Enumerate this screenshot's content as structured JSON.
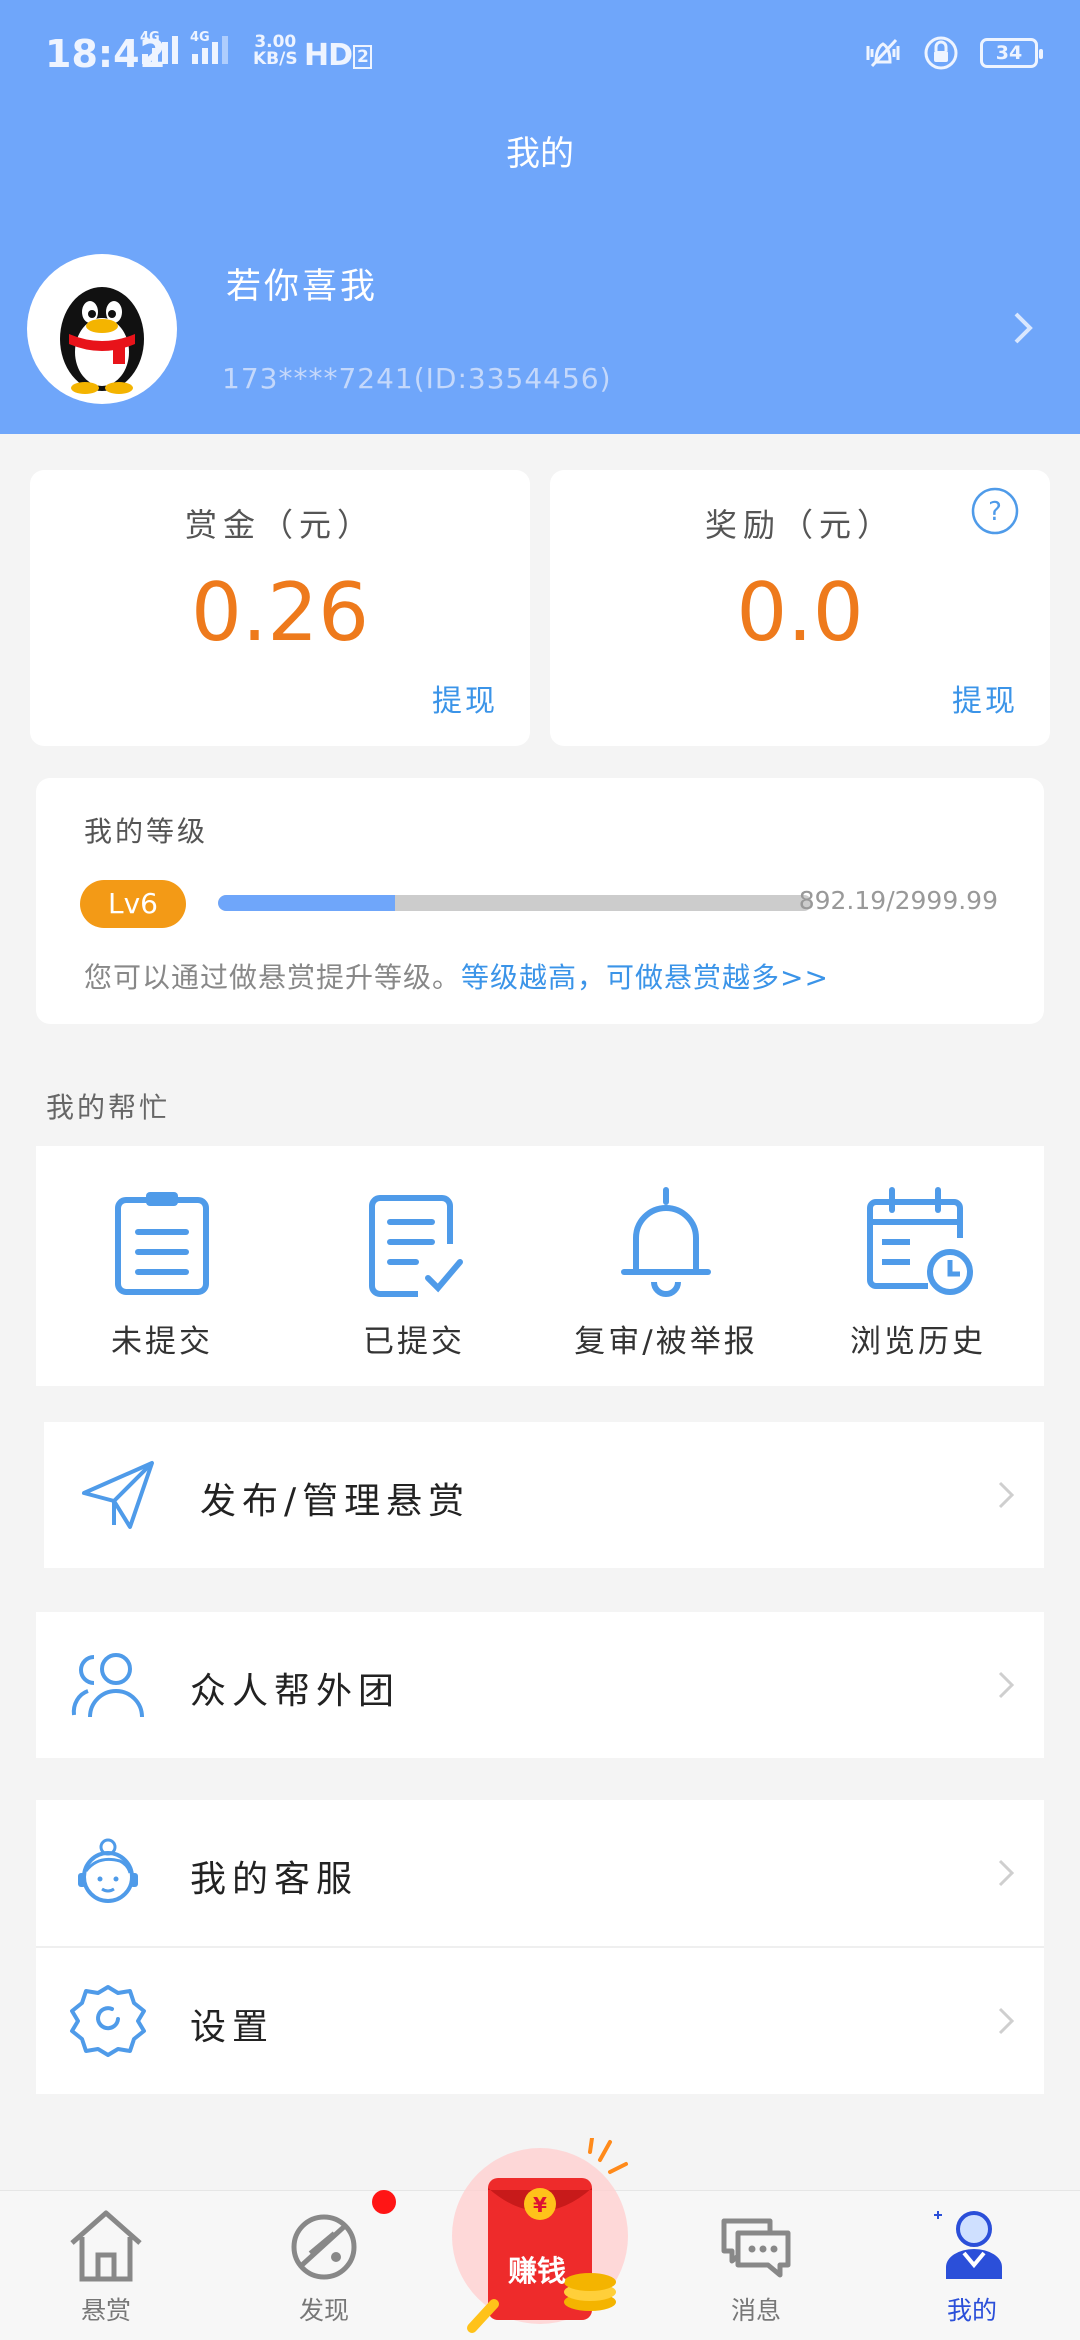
{
  "status_bar": {
    "time": "18:42",
    "network_tag_1": "4G",
    "network_tag_2": "4G",
    "speed_value": "3.00",
    "speed_unit": "KB/S",
    "hd": "HD",
    "hd_num": "2",
    "battery": "34"
  },
  "header": {
    "title": "我的",
    "username": "若你喜我",
    "user_id": "173****7241(ID:3354456)"
  },
  "wallet": {
    "bounty_label": "赏金（元）",
    "bounty_value": "0.26",
    "bounty_withdraw": "提现",
    "reward_label": "奖励（元）",
    "reward_value": "0.0",
    "reward_withdraw": "提现"
  },
  "level": {
    "title": "我的等级",
    "badge": "Lv6",
    "progress": 0.2975,
    "score": "892.19/2999.99",
    "tip": "您可以通过做悬赏提升等级。",
    "tip_link": "等级越高，可做悬赏越多>>"
  },
  "help": {
    "section_title": "我的帮忙",
    "items": [
      {
        "label": "未提交",
        "icon": "clipboard-icon"
      },
      {
        "label": "已提交",
        "icon": "checked-document-icon"
      },
      {
        "label": "复审/被举报",
        "icon": "bell-icon"
      },
      {
        "label": "浏览历史",
        "icon": "calendar-clock-icon"
      }
    ]
  },
  "menu": {
    "publish": "发布/管理悬赏",
    "team": "众人帮外团",
    "service": "我的客服",
    "settings": "设置"
  },
  "nav": {
    "items": [
      {
        "label": "悬赏",
        "icon": "home-icon"
      },
      {
        "label": "发现",
        "icon": "planet-icon"
      },
      {
        "label": "消息",
        "icon": "chat-icon"
      },
      {
        "label": "我的",
        "icon": "profile-icon"
      }
    ],
    "earn_label": "赚钱",
    "earn_coin": "¥",
    "active_color": "#2b4fd9"
  },
  "colors": {
    "header_bg": "#6fa6fa",
    "amount": "#ee7a1c",
    "link": "#3b94e8",
    "badge": "#f39a16"
  }
}
